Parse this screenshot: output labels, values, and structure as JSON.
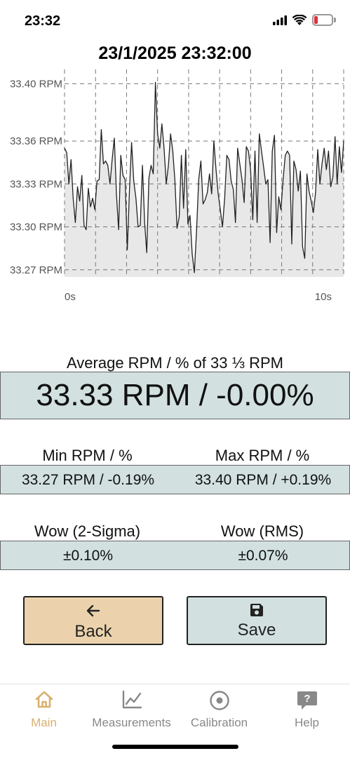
{
  "status_bar": {
    "time": "23:32",
    "battery": "15",
    "icons": [
      "signal-icon",
      "wifi-icon",
      "battery-icon"
    ]
  },
  "header": {
    "timestamp": "23/1/2025 23:32:00"
  },
  "chart_data": {
    "type": "area",
    "x_unit": "s",
    "x_tick_labels": [
      "0s",
      "10s"
    ],
    "xlim": [
      0,
      10
    ],
    "y_tick_labels": [
      "33.40 RPM",
      "33.36 RPM",
      "33.33 RPM",
      "33.30 RPM",
      "33.27 RPM"
    ],
    "y_ticks": [
      33.4,
      33.36,
      33.33,
      33.3,
      33.27
    ],
    "ylim": [
      33.265,
      33.41
    ],
    "grid": true,
    "series": [
      {
        "values": [
          33.355,
          33.352,
          33.33,
          33.347,
          33.32,
          33.303,
          33.328,
          33.318,
          33.336,
          33.301,
          33.298,
          33.327,
          33.314,
          33.32,
          33.312,
          33.332,
          33.333,
          33.368,
          33.344,
          33.346,
          33.343,
          33.33,
          33.347,
          33.362,
          33.323,
          33.298,
          33.35,
          33.336,
          33.333,
          33.284,
          33.326,
          33.359,
          33.332,
          33.32,
          33.3,
          33.301,
          33.343,
          33.303,
          33.282,
          33.334,
          33.343,
          33.337,
          33.401,
          33.365,
          33.355,
          33.372,
          33.355,
          33.33,
          33.343,
          33.365,
          33.353,
          33.333,
          33.299,
          33.307,
          33.35,
          33.313,
          33.354,
          33.302,
          33.308,
          33.281,
          33.268,
          33.297,
          33.333,
          33.346,
          33.316,
          33.319,
          33.324,
          33.337,
          33.323,
          33.36,
          33.34,
          33.323,
          33.312,
          33.3,
          33.32,
          33.35,
          33.347,
          33.332,
          33.326,
          33.303,
          33.355,
          33.344,
          33.333,
          33.317,
          33.356,
          33.353,
          33.34,
          33.305,
          33.353,
          33.303,
          33.365,
          33.353,
          33.342,
          33.33,
          33.333,
          33.289,
          33.353,
          33.364,
          33.296,
          33.321,
          33.312,
          33.333,
          33.35,
          33.353,
          33.35,
          33.288,
          33.346,
          33.34,
          33.325,
          33.339,
          33.286,
          33.278,
          33.337,
          33.325,
          33.318,
          33.31,
          33.324,
          33.354,
          33.33,
          33.344,
          33.355,
          33.34,
          33.353,
          33.328,
          33.335,
          33.363,
          33.33,
          33.356,
          33.338,
          33.36
        ]
      }
    ],
    "line_color": "#222222",
    "fill_color": "#e8e8e8"
  },
  "average": {
    "label": "Average RPM / % of 33 ⅓ RPM",
    "value": "33.33 RPM / -0.00%"
  },
  "min": {
    "label": "Min RPM / %",
    "value": "33.27 RPM / -0.19%"
  },
  "max": {
    "label": "Max RPM / %",
    "value": "33.40 RPM / +0.19%"
  },
  "wow_2sigma": {
    "label": "Wow (2-Sigma)",
    "value": "±0.10%"
  },
  "wow_rms": {
    "label": "Wow (RMS)",
    "value": "±0.07%"
  },
  "buttons": {
    "back": {
      "label": "Back",
      "icon": "arrow-left-icon",
      "color": "#ecd2ac"
    },
    "save": {
      "label": "Save",
      "icon": "save-icon",
      "color": "#d2e0e0"
    }
  },
  "tabs": [
    {
      "label": "Main",
      "icon": "home-icon",
      "active": true
    },
    {
      "label": "Measurements",
      "icon": "chart-icon",
      "active": false
    },
    {
      "label": "Calibration",
      "icon": "target-icon",
      "active": false
    },
    {
      "label": "Help",
      "icon": "help-icon",
      "active": false
    }
  ],
  "colors": {
    "accent": "#d8b070",
    "tab_inactive": "#888888",
    "panel": "#d2e0e0",
    "back_button": "#ecd2ac"
  }
}
